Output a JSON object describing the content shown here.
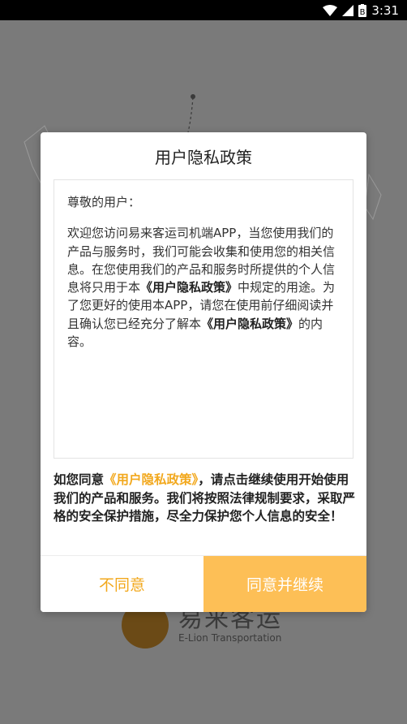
{
  "status_bar": {
    "time": "3:31",
    "icons": [
      "wifi-icon",
      "signal-icon",
      "battery-icon"
    ],
    "battery_glyph": "B"
  },
  "background": {
    "logo_name": "易来客运",
    "logo_subtitle": "E-Lion Transportation"
  },
  "dialog": {
    "title": "用户隐私政策",
    "greeting": "尊敬的用户：",
    "body_part1": "欢迎您访问易来客运司机端APP，当您使用我们的产品与服务时，我们可能会收集和使用您的相关信息。在您使用我们的产品和服务时所提供的个人信息将只用于本",
    "policy_name": "《用户隐私政策》",
    "body_part2": "中规定的用途。为了您更好的使用本APP，请您在使用前仔细阅读并且确认您已经充分了解本",
    "body_part3": "的内容。",
    "consent_prefix": "如您同意",
    "consent_suffix": "，请点击继续使用开始使用我们的产品和服务。我们将按照法律规制要求，采取严格的安全保护措施，尽全力保护您个人信息的安全！",
    "disagree_label": "不同意",
    "agree_label": "同意并继续"
  },
  "colors": {
    "accent": "#f2a81d",
    "agree_bg": "#fdbf56",
    "overlay": "#7a7a7a"
  }
}
